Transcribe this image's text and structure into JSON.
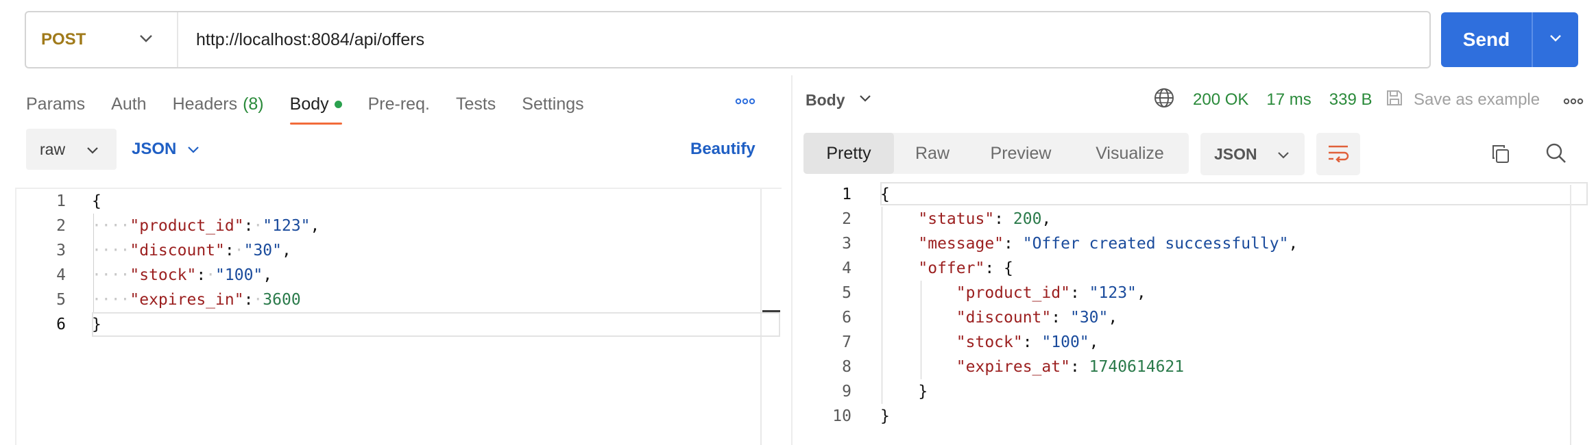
{
  "request": {
    "method": "POST",
    "url": "http://localhost:8084/api/offers",
    "send_label": "Send"
  },
  "request_tabs": [
    {
      "label": "Params"
    },
    {
      "label": "Auth"
    },
    {
      "label": "Headers",
      "count": "(8)"
    },
    {
      "label": "Body",
      "active": true
    },
    {
      "label": "Pre-req."
    },
    {
      "label": "Tests"
    },
    {
      "label": "Settings"
    }
  ],
  "body_options": {
    "mode": "raw",
    "language": "JSON",
    "beautify_label": "Beautify"
  },
  "request_body_lines": [
    "1",
    "2",
    "3",
    "4",
    "5",
    "6"
  ],
  "request_body": {
    "open": "{",
    "close": "}",
    "entries": [
      {
        "key": "\"product_id\"",
        "value": "\"123\"",
        "comma": ","
      },
      {
        "key": "\"discount\"",
        "value": "\"30\"",
        "comma": ","
      },
      {
        "key": "\"stock\"",
        "value": "\"100\"",
        "comma": ","
      },
      {
        "key": "\"expires_in\"",
        "value": "3600",
        "comma": ""
      }
    ]
  },
  "response": {
    "section_label": "Body",
    "status": "200 OK",
    "time": "17 ms",
    "size": "339 B",
    "save_example_label": "Save as example",
    "view_tabs": [
      "Pretty",
      "Raw",
      "Preview",
      "Visualize"
    ],
    "active_view": "Pretty",
    "format": "JSON"
  },
  "response_body_lines": [
    "1",
    "2",
    "3",
    "4",
    "5",
    "6",
    "7",
    "8",
    "9",
    "10"
  ],
  "response_body": {
    "open": "{",
    "close": "}",
    "status_key": "\"status\"",
    "status_val": "200",
    "message_key": "\"message\"",
    "message_val": "\"Offer created successfully\"",
    "offer_key": "\"offer\"",
    "offer_open": "{",
    "offer_close": "}",
    "offer_entries": [
      {
        "key": "\"product_id\"",
        "value": "\"123\"",
        "comma": ","
      },
      {
        "key": "\"discount\"",
        "value": "\"30\"",
        "comma": ","
      },
      {
        "key": "\"stock\"",
        "value": "\"100\"",
        "comma": ","
      },
      {
        "key": "\"expires_at\"",
        "value": "1740614621",
        "comma": ""
      }
    ]
  },
  "colors": {
    "accent": "#2f6fdd",
    "method": "#a07a1a",
    "key": "#9b1f1f",
    "string": "#1a4b9c",
    "number": "#2a7a4a",
    "active_tab_underline": "#f26b3a",
    "status_ok": "#2a8a3a"
  },
  "icons": [
    "chevron-down-icon",
    "more-icon",
    "globe-icon",
    "save-icon",
    "wrap-icon",
    "copy-icon",
    "search-icon"
  ]
}
